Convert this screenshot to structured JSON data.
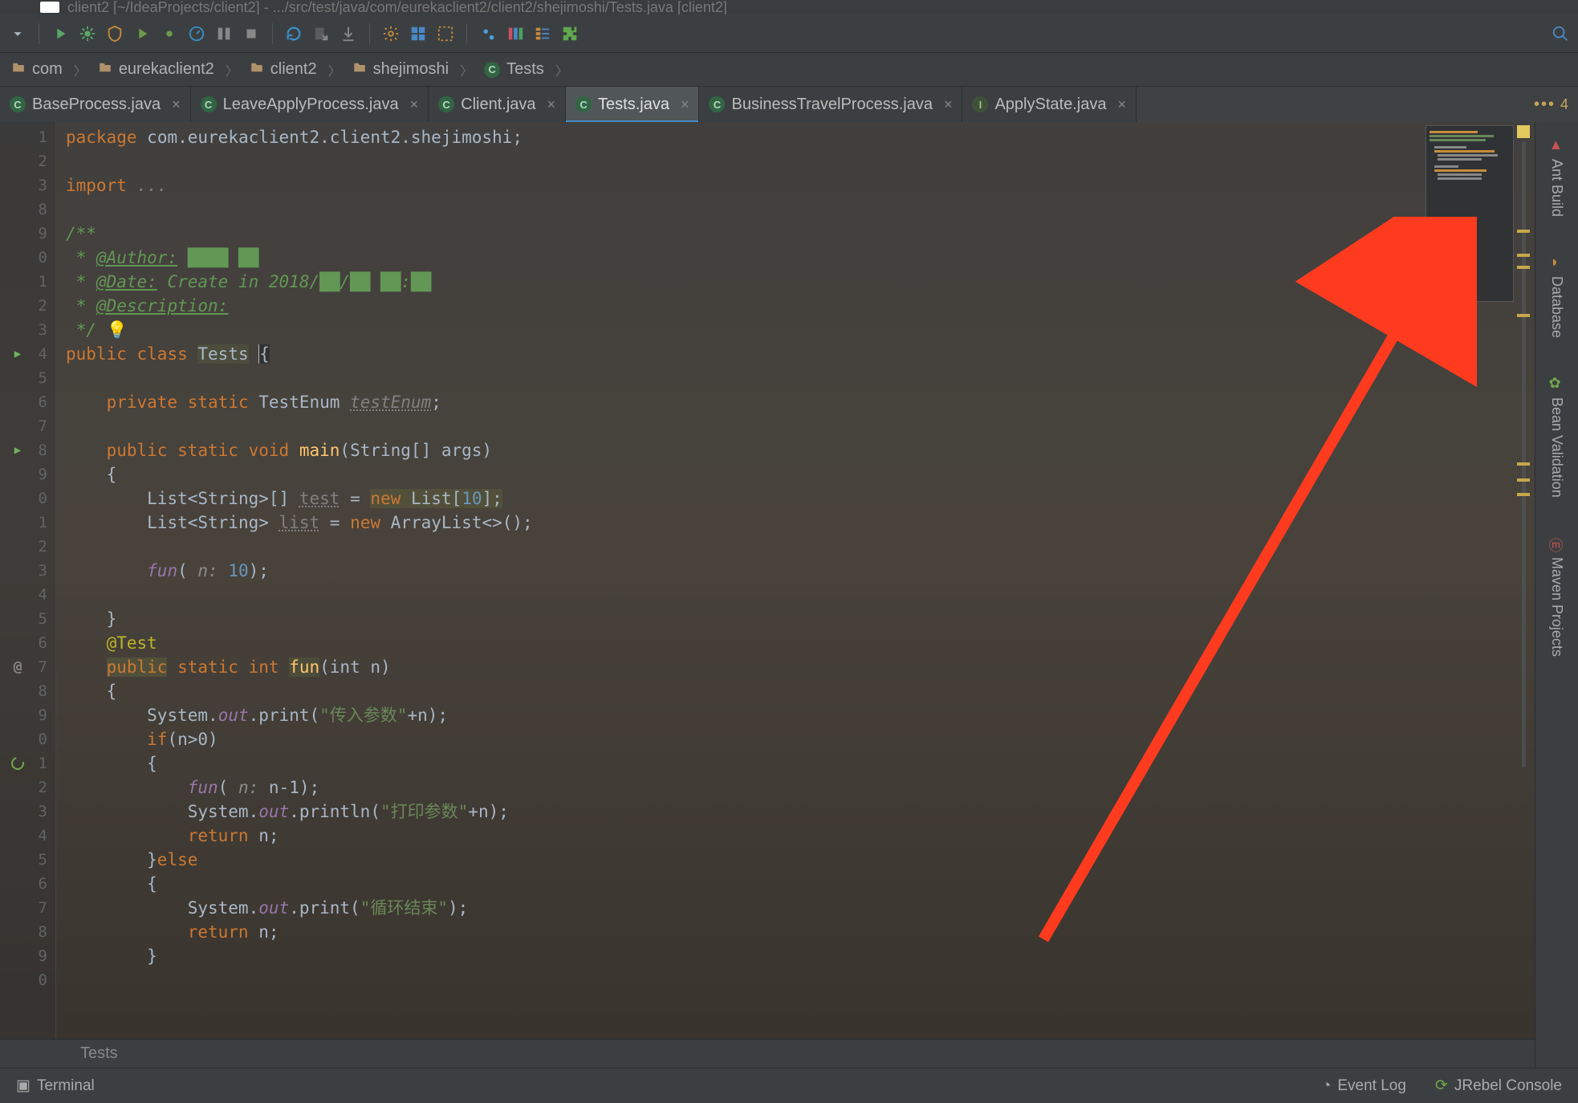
{
  "titlebar": {
    "text": "client2 [~/IdeaProjects/client2] - .../src/test/java/com/eurekaclient2/client2/shejimoshi/Tests.java [client2]"
  },
  "breadcrumbs": {
    "items": [
      {
        "icon": "folder",
        "label": "com"
      },
      {
        "icon": "folder",
        "label": "eurekaclient2"
      },
      {
        "icon": "folder",
        "label": "client2"
      },
      {
        "icon": "folder",
        "label": "shejimoshi"
      },
      {
        "icon": "class",
        "label": "Tests"
      }
    ]
  },
  "tabs": {
    "items": [
      {
        "icon": "class",
        "label": "BaseProcess.java",
        "active": false
      },
      {
        "icon": "class",
        "label": "LeaveApplyProcess.java",
        "active": false
      },
      {
        "icon": "class",
        "label": "Client.java",
        "active": false
      },
      {
        "icon": "class",
        "label": "Tests.java",
        "active": true
      },
      {
        "icon": "class",
        "label": "BusinessTravelProcess.java",
        "active": false
      },
      {
        "icon": "interface",
        "label": "ApplyState.java",
        "active": false
      }
    ],
    "overflow_count": "4"
  },
  "code": {
    "package_kw": "package",
    "package_name": "com.eurekaclient2.client2.shejimoshi",
    "import_kw": "import",
    "import_ellipsis": "...",
    "doc_open": "/**",
    "doc_author_tag": "@Author:",
    "doc_author_val": "████ ██",
    "doc_date_tag": "@Date:",
    "doc_date_val": "Create in 2018/██/██ ██:██",
    "doc_desc_tag": "@Description:",
    "doc_close": " */",
    "class_decl_public": "public",
    "class_decl_class": "class",
    "class_name": "Tests",
    "brace_open": "{",
    "field_private": "private",
    "field_static": "static",
    "field_type": "TestEnum",
    "field_name": "testEnum",
    "main_public": "public",
    "main_static": "static",
    "main_void": "void",
    "main_name": "main",
    "main_params": "(String[] args)",
    "list_decl1_type": "List<String>[]",
    "list_decl1_var": "test",
    "list_decl1_eq": "=",
    "list_decl1_new": "new",
    "list_decl1_rhs": "List[",
    "list_decl1_num": "10",
    "list_decl1_end": "];",
    "list_decl2_type": "List<String>",
    "list_decl2_var": "list",
    "list_decl2_eq": "=",
    "list_decl2_new": "new",
    "list_decl2_rhs": "ArrayList<>();",
    "fun_call_name": "fun",
    "fun_call_open": "(",
    "fun_call_hint": "n:",
    "fun_call_arg": "10",
    "fun_call_close": ");",
    "annotation": "@Test",
    "fun_public": "public",
    "fun_static": "static",
    "fun_ret": "int",
    "fun_name": "fun",
    "fun_params": "(int n)",
    "sys": "System",
    "out": "out",
    "print": "print",
    "println": "println",
    "str_in": "\"传入参数\"",
    "plus_n": "+n);",
    "if_kw": "if",
    "if_cond": "(n>0)",
    "fun2_hint": "n:",
    "fun2_arg": "n-1",
    "fun2_close": ");",
    "str_out": "\"打印参数\"",
    "return_kw": "return",
    "return_val": "n;",
    "else_kw": "else",
    "str_end": "\"循环结束\"",
    "close_paren": ");"
  },
  "crumb": {
    "text": "Tests"
  },
  "rightTools": {
    "items": [
      {
        "label": "Ant Build"
      },
      {
        "label": "Database"
      },
      {
        "label": "Bean Validation"
      },
      {
        "label": "Maven Projects"
      }
    ]
  },
  "statusbar": {
    "terminal": "Terminal",
    "eventlog": "Event Log",
    "jrebel": "JRebel Console"
  }
}
